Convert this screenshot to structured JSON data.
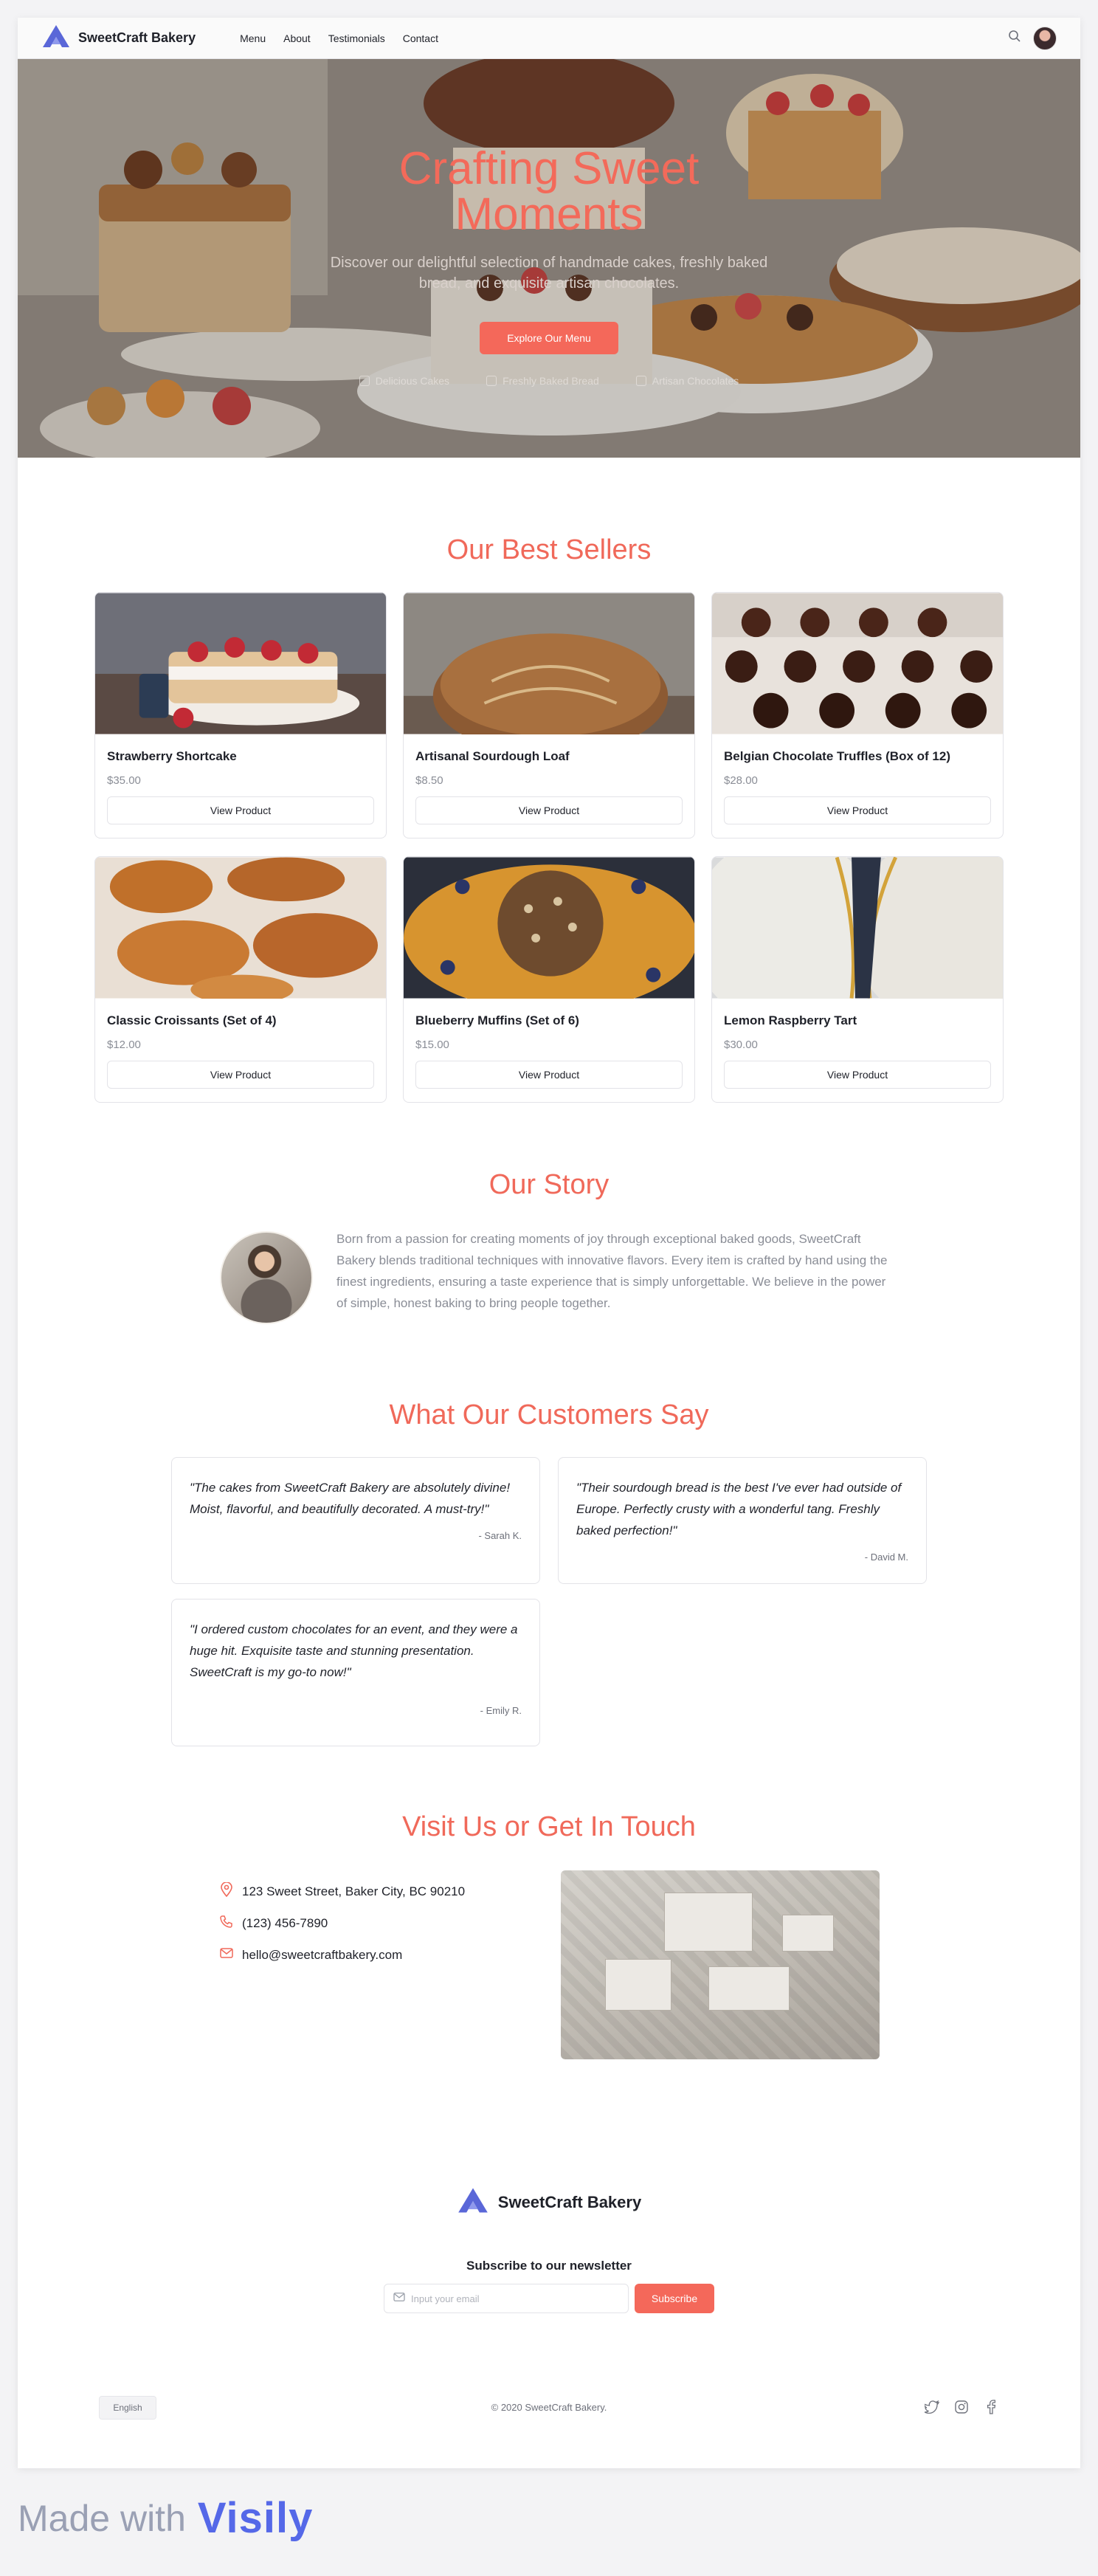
{
  "header": {
    "brand": "SweetCraft Bakery",
    "nav": [
      "Menu",
      "About",
      "Testimonials",
      "Contact"
    ]
  },
  "hero": {
    "title": "Crafting Sweet Moments",
    "subtitle": "Discover our delightful selection of handmade cakes, freshly baked bread, and exquisite artisan chocolates.",
    "cta": "Explore Our Menu",
    "features": [
      "Delicious Cakes",
      "Freshly Baked Bread",
      "Artisan Chocolates"
    ]
  },
  "best_sellers": {
    "title": "Our Best Sellers",
    "button_label": "View Product",
    "products": [
      {
        "name": "Strawberry Shortcake",
        "price": "$35.00"
      },
      {
        "name": "Artisanal Sourdough Loaf",
        "price": "$8.50"
      },
      {
        "name": "Belgian Chocolate Truffles (Box of 12)",
        "price": "$28.00"
      },
      {
        "name": "Classic Croissants (Set of 4)",
        "price": "$12.00"
      },
      {
        "name": "Blueberry Muffins (Set of 6)",
        "price": "$15.00"
      },
      {
        "name": "Lemon Raspberry Tart",
        "price": "$30.00"
      }
    ]
  },
  "story": {
    "title": "Our Story",
    "text": "Born from a passion for creating moments of joy through exceptional baked goods, SweetCraft Bakery blends traditional techniques with innovative flavors. Every item is crafted by hand using the finest ingredients, ensuring a taste experience that is simply unforgettable. We believe in the power of simple, honest baking to bring people together."
  },
  "testimonials": {
    "title": "What Our Customers Say",
    "items": [
      {
        "quote": "\"The cakes from SweetCraft Bakery are absolutely divine! Moist, flavorful, and beautifully decorated. A must-try!\"",
        "author": "- Sarah K."
      },
      {
        "quote": "\"Their sourdough bread is the best I've ever had outside of Europe. Perfectly crusty with a wonderful tang. Freshly baked perfection!\"",
        "author": "- David M."
      },
      {
        "quote": "\"I ordered custom chocolates for an event, and they were a huge hit. Exquisite taste and stunning presentation. SweetCraft is my go-to now!\"",
        "author": "- Emily R."
      }
    ]
  },
  "contact": {
    "title": "Visit Us or Get In Touch",
    "address": "123 Sweet Street, Baker City, BC 90210",
    "phone": "(123) 456-7890",
    "email": "hello@sweetcraftbakery.com"
  },
  "footer": {
    "brand": "SweetCraft Bakery",
    "newsletter_title": "Subscribe to our newsletter",
    "email_placeholder": "Input your email",
    "subscribe": "Subscribe",
    "language": "English",
    "copyright": "© 2020 SweetCraft Bakery."
  },
  "made_with": {
    "label": "Made with",
    "logo": "Visily"
  },
  "colors": {
    "accent": "#f4685a",
    "brand": "#5568e8",
    "text": "#1f2129",
    "muted": "#8a8d96"
  }
}
